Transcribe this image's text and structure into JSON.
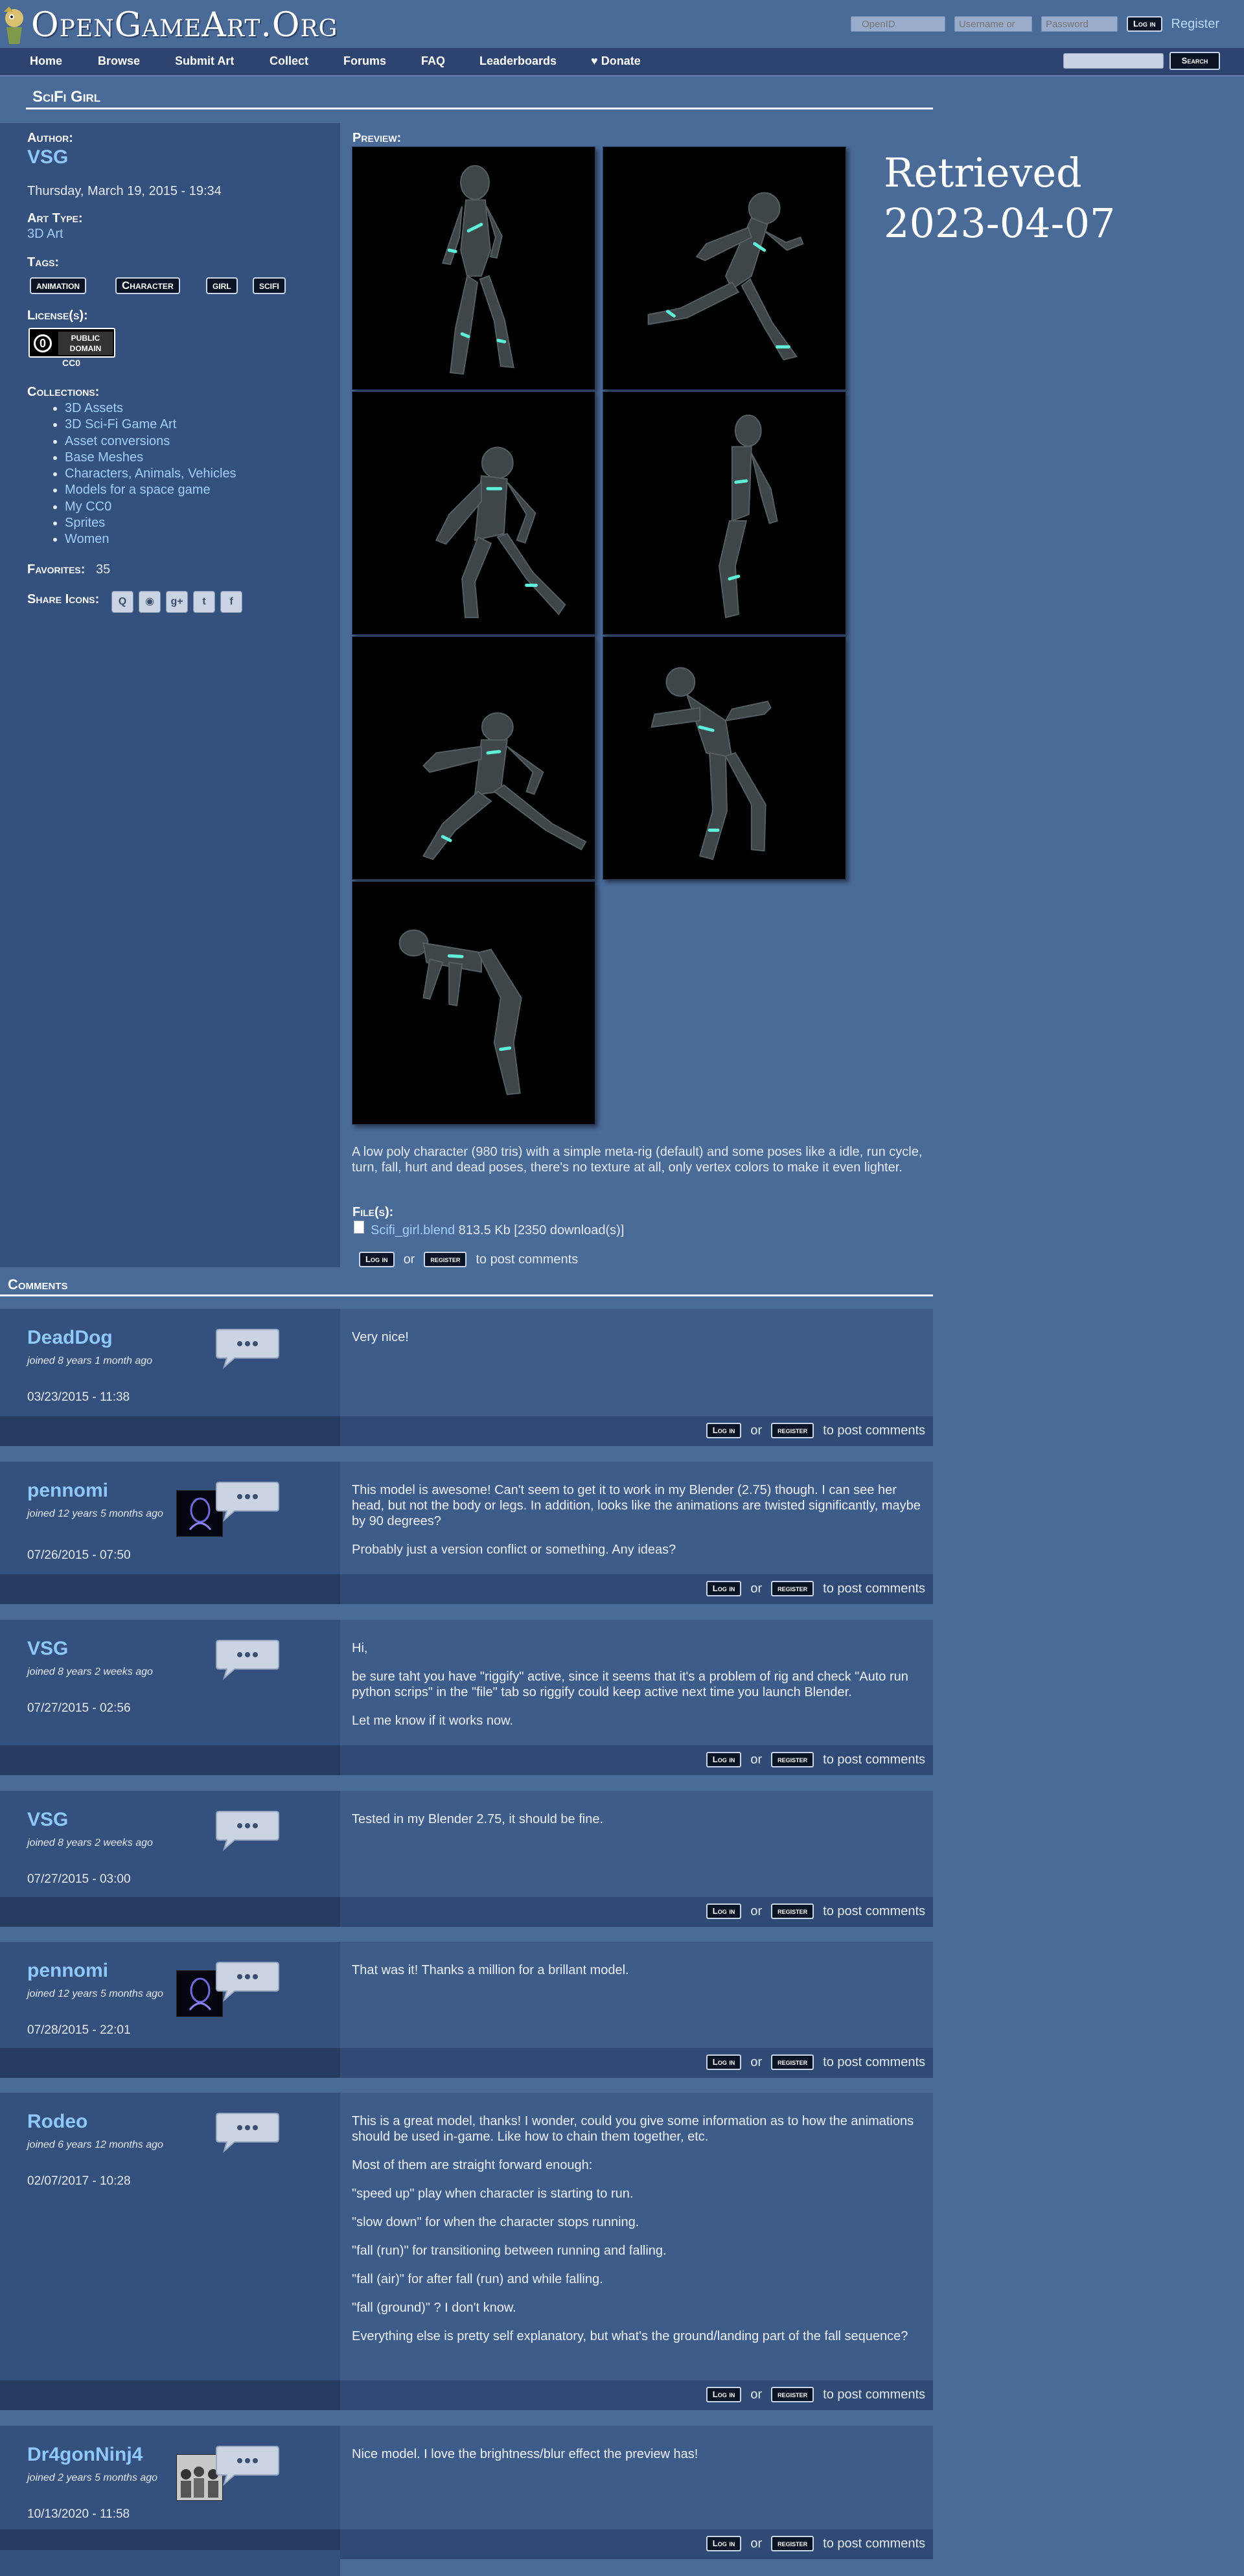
{
  "header": {
    "site_name": "OpenGameArt.Org",
    "openid_placeholder": "OpenID",
    "username_placeholder": "Username or",
    "password_placeholder": "Password",
    "login_label": "Log in",
    "register_label": "Register"
  },
  "nav": {
    "items": [
      "Home",
      "Browse",
      "Submit Art",
      "Collect",
      "Forums",
      "FAQ",
      "Leaderboards",
      "Donate"
    ],
    "search_label": "Search"
  },
  "page": {
    "title": "SciFi Girl",
    "author_label": "Author:",
    "author": "VSG",
    "date": "Thursday, March 19, 2015 - 19:34",
    "art_type_label": "Art Type:",
    "art_type": "3D Art",
    "tags_label": "Tags:",
    "tags": [
      "animation",
      "Character",
      "girl",
      "scifi"
    ],
    "license_label": "License(s):",
    "license_badge_text": "PUBLIC DOMAIN",
    "license_badge_symbol": "0",
    "license_name": "CC0",
    "collections_label": "Collections:",
    "collections": [
      "3D Assets",
      "3D Sci-Fi Game Art",
      "Asset conversions",
      "Base Meshes",
      "Characters, Animals, Vehicles",
      "Models for a space game",
      "My CC0",
      "Sprites",
      "Women"
    ],
    "favorites_label": "Favorites:",
    "favorites": "35",
    "share_label": "Share Icons:",
    "preview_label": "Preview:",
    "retrieved_line1": "Retrieved",
    "retrieved_line2": "2023-04-07",
    "description": "A low poly character (980 tris) with a simple meta-rig (default) and some poses like a idle, run cycle, turn, fall, hurt and dead poses, there's no texture at all, only vertex colors to make it even lighter.",
    "files_label": "File(s):",
    "file_name": "Scifi_girl.blend",
    "file_meta": "813.5 Kb [2350 download(s)]",
    "login_label": "Log in",
    "or_text": "or",
    "register_label": "register",
    "post_text": "to post comments"
  },
  "comments_title": "Comments",
  "comments": [
    {
      "author": "DeadDog",
      "joined": "joined 8 years 1 month ago",
      "date": "03/23/2015 - 11:38",
      "body": [
        "Very nice!"
      ]
    },
    {
      "author": "pennomi",
      "joined": "joined 12 years 5 months ago",
      "date": "07/26/2015 - 07:50",
      "body": [
        "This model is awesome! Can't seem to get it to work in my Blender (2.75) though. I can see her head, but not the body or legs. In addition, looks like the animations are twisted significantly, maybe by 90 degrees?",
        "Probably just a version conflict or something. Any ideas?"
      ]
    },
    {
      "author": "VSG",
      "joined": "joined 8 years 2 weeks ago",
      "date": "07/27/2015 - 02:56",
      "body": [
        "Hi,",
        "be sure taht you have \"riggify\" active, since it seems that it's a problem of rig and check \"Auto run python scrips\" in the \"file\" tab so riggify could keep active next time you launch Blender.",
        "Let me know if it works now."
      ]
    },
    {
      "author": "VSG",
      "joined": "joined 8 years 2 weeks ago",
      "date": "07/27/2015 - 03:00",
      "body": [
        "Tested in my Blender 2.75, it should be fine."
      ]
    },
    {
      "author": "pennomi",
      "joined": "joined 12 years 5 months ago",
      "date": "07/28/2015 - 22:01",
      "body": [
        "That was it! Thanks a million for a brillant model."
      ]
    },
    {
      "author": "Rodeo",
      "joined": "joined 6 years 12 months ago",
      "date": "02/07/2017 - 10:28",
      "body": [
        "This is a great model, thanks! I wonder, could you give some information as to how the animations should be used in-game. Like how to chain them together, etc.",
        "Most of them are straight forward enough:",
        "\"speed up\" play when character is starting to run.",
        "\"slow down\" for when the character stops running.",
        "\"fall (run)\" for transitioning between running and falling.",
        "\"fall (air)\" for after fall (run) and while falling.",
        "\"fall (ground)\" ? I don't know.",
        "Everything else is pretty self explanatory, but what's the ground/landing part of the fall sequence?"
      ]
    },
    {
      "author": "Dr4gonNinj4",
      "joined": "joined 2 years 5 months ago",
      "date": "10/13/2020 - 11:58",
      "body": [
        "Nice model. I love the brightness/blur effect the preview has!"
      ]
    }
  ]
}
